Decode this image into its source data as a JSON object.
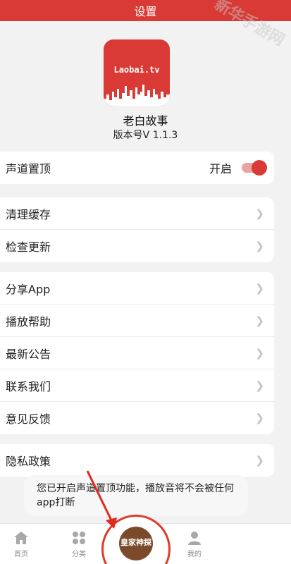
{
  "header": {
    "title": "设置"
  },
  "app": {
    "logo_text": "Laobai.tv",
    "name": "老白故事",
    "version": "版本号V 1.1.3"
  },
  "settings": {
    "channel_top": {
      "label": "声道置顶",
      "status": "开启",
      "enabled": true
    },
    "group2": [
      {
        "label": "清理缓存"
      },
      {
        "label": "检查更新"
      }
    ],
    "group3": [
      {
        "label": "分享App"
      },
      {
        "label": "播放帮助"
      },
      {
        "label": "最新公告"
      },
      {
        "label": "联系我们"
      },
      {
        "label": "意见反馈"
      }
    ],
    "group4": [
      {
        "label": "隐私政策"
      }
    ]
  },
  "toast": {
    "text": "您已开启声道置顶功能，播放音将不会被任何app打断"
  },
  "tabbar": {
    "items": [
      {
        "label": "首页",
        "icon": "home-icon"
      },
      {
        "label": "分类",
        "icon": "category-icon"
      },
      {
        "label": "我的",
        "icon": "profile-icon"
      }
    ],
    "player": {
      "disc_text": "皇家神探"
    }
  },
  "watermark": {
    "text": "新华手游网"
  },
  "colors": {
    "accent": "#d93a35",
    "background": "#f2f2f2"
  }
}
